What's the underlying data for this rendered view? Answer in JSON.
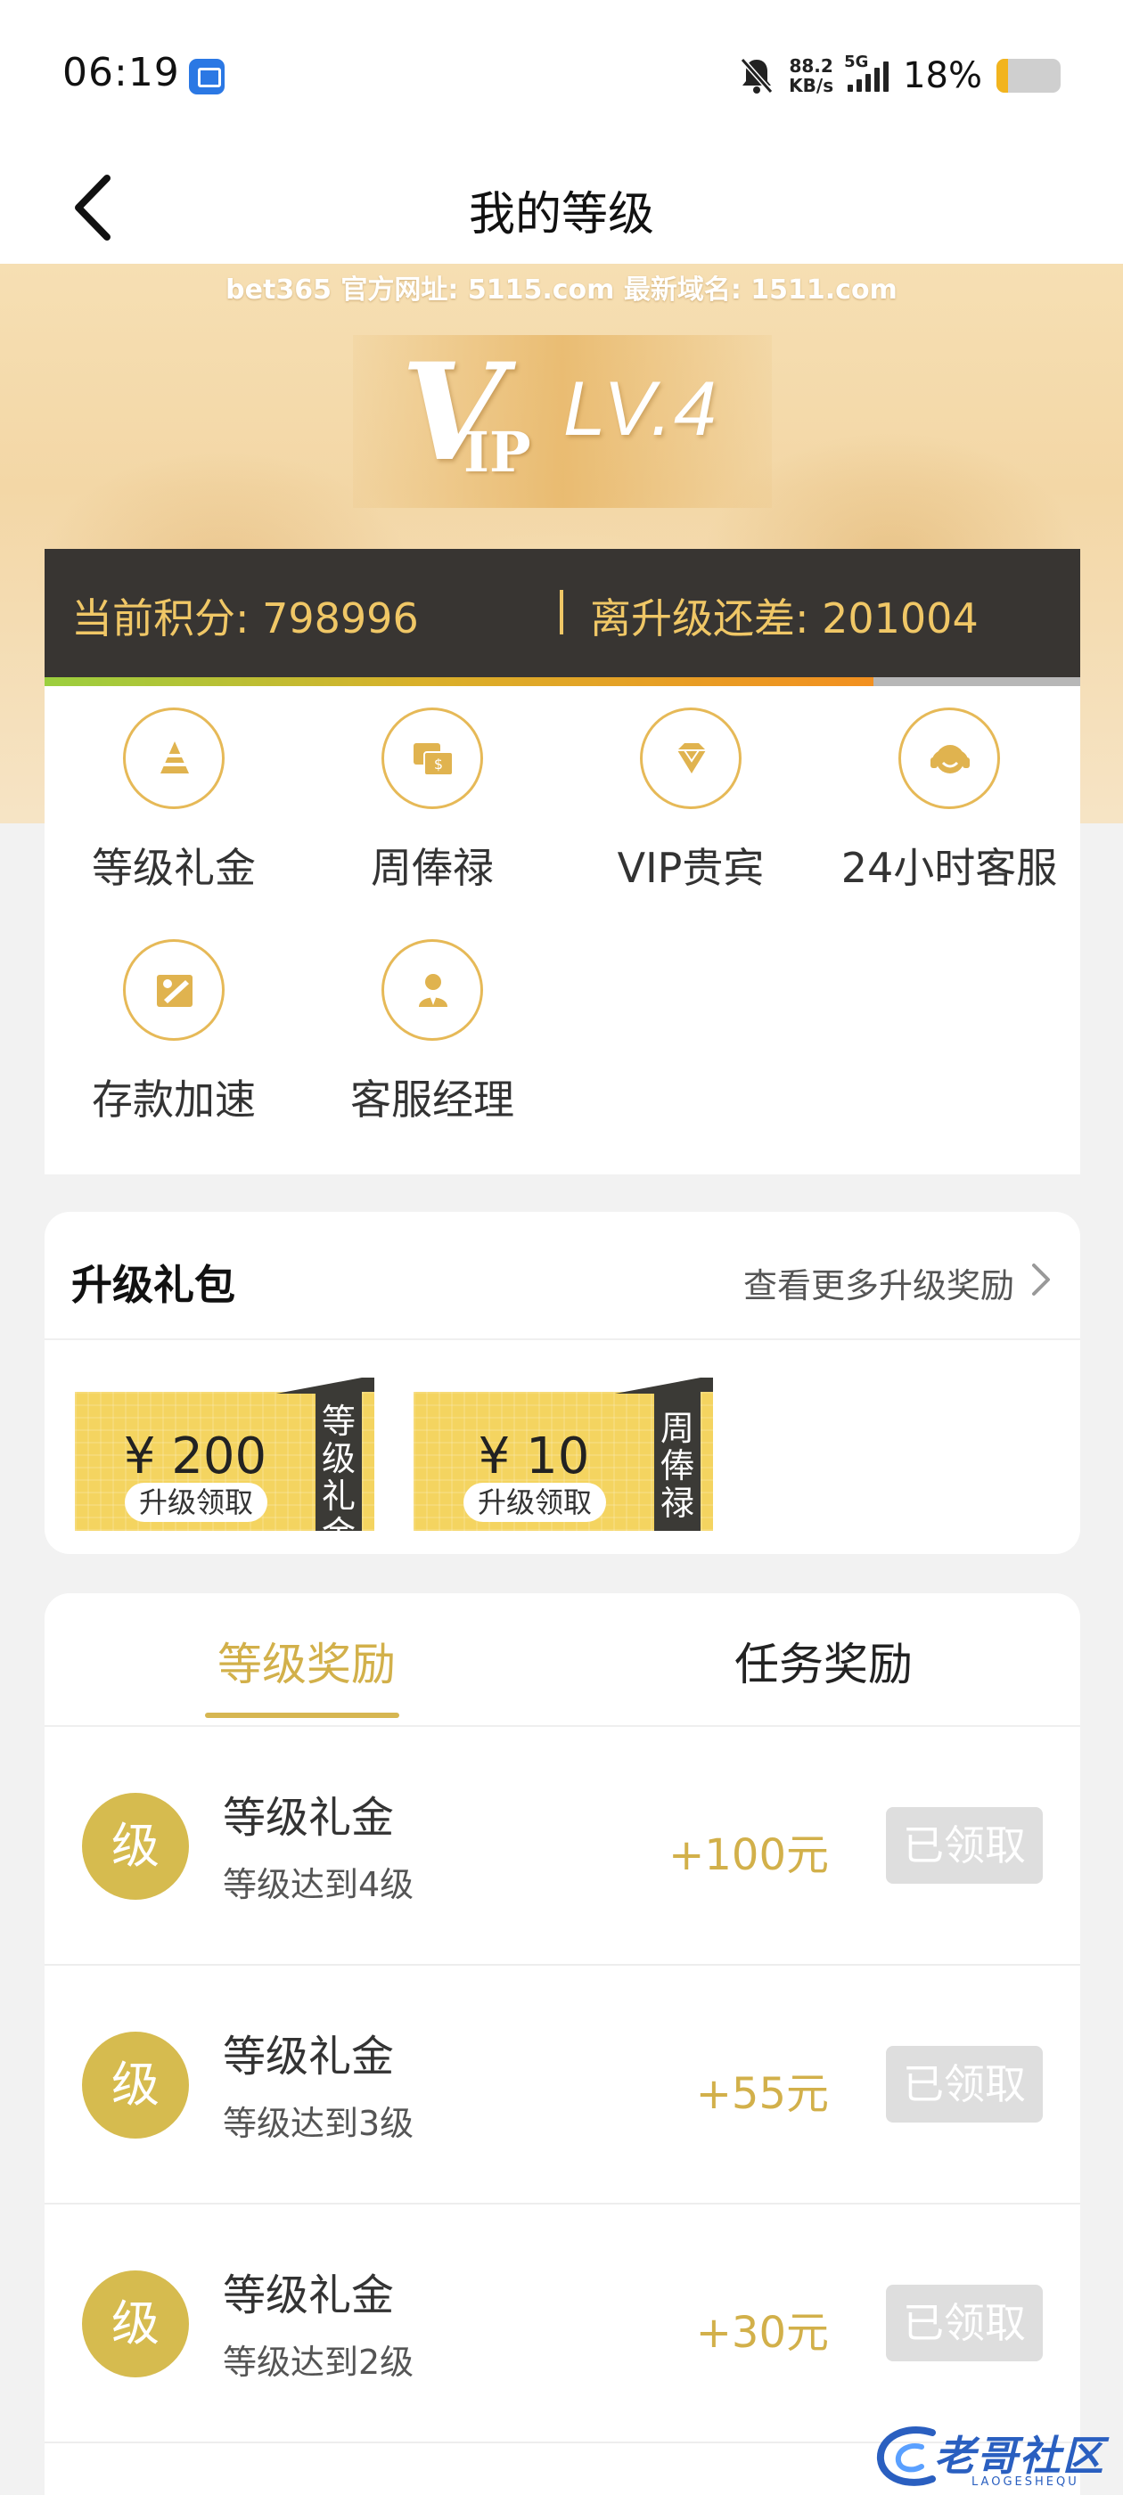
{
  "status_bar": {
    "time": "06:19",
    "net_speed_value": "88.2",
    "net_speed_unit": "KB/s",
    "network": "5G",
    "battery_percent": "18%",
    "battery_level": 0.18,
    "icons": [
      "app-notification-icon",
      "bell-muted-icon",
      "signal-icon",
      "battery-icon"
    ]
  },
  "nav": {
    "title": "我的等级",
    "back_icon": "chevron-left-icon"
  },
  "hero": {
    "banner": "bet365 官方网址: 5115.com 最新域名: 1511.com",
    "vip_v": "V",
    "vip_ip": "IP",
    "level": "LV.4"
  },
  "score": {
    "current": "当前积分: 798996",
    "remaining": "离升级还差: 201004",
    "progress": 0.8
  },
  "privileges": [
    {
      "label": "等级礼金",
      "icon": "pyramid-icon"
    },
    {
      "label": "周俸禄",
      "icon": "money-chat-icon"
    },
    {
      "label": "VIP贵宾",
      "icon": "diamond-icon"
    },
    {
      "label": "24小时客服",
      "icon": "headset-icon"
    },
    {
      "label": "存款加速",
      "icon": "rocket-icon"
    },
    {
      "label": "客服经理",
      "icon": "manager-icon"
    }
  ],
  "upgrade_gift": {
    "title": "升级礼包",
    "more": "查看更多升级奖励",
    "vouchers": [
      {
        "amount": "¥ 200",
        "pill": "升级领取",
        "tag": "等级礼金"
      },
      {
        "amount": "¥ 10",
        "pill": "升级领取",
        "tag": "周俸禄"
      }
    ]
  },
  "rewards": {
    "tabs": [
      {
        "label": "等级奖励",
        "active": true
      },
      {
        "label": "任务奖励",
        "active": false
      }
    ],
    "rows": [
      {
        "badge": "级",
        "title": "等级礼金",
        "subtitle": "等级达到4级",
        "amount": "+100元",
        "button": "已领取"
      },
      {
        "badge": "级",
        "title": "等级礼金",
        "subtitle": "等级达到3级",
        "amount": "+55元",
        "button": "已领取"
      },
      {
        "badge": "级",
        "title": "等级礼金",
        "subtitle": "等级达到2级",
        "amount": "+30元",
        "button": "已领取"
      }
    ]
  },
  "watermark": {
    "text": "老哥社区",
    "sub": "LAOGESHEQU"
  },
  "colors": {
    "gold": "#d2b04a",
    "score_bg": "#383532",
    "score_text": "#f0c766",
    "voucher": "#f4d460",
    "disabled_btn": "#dedede"
  }
}
